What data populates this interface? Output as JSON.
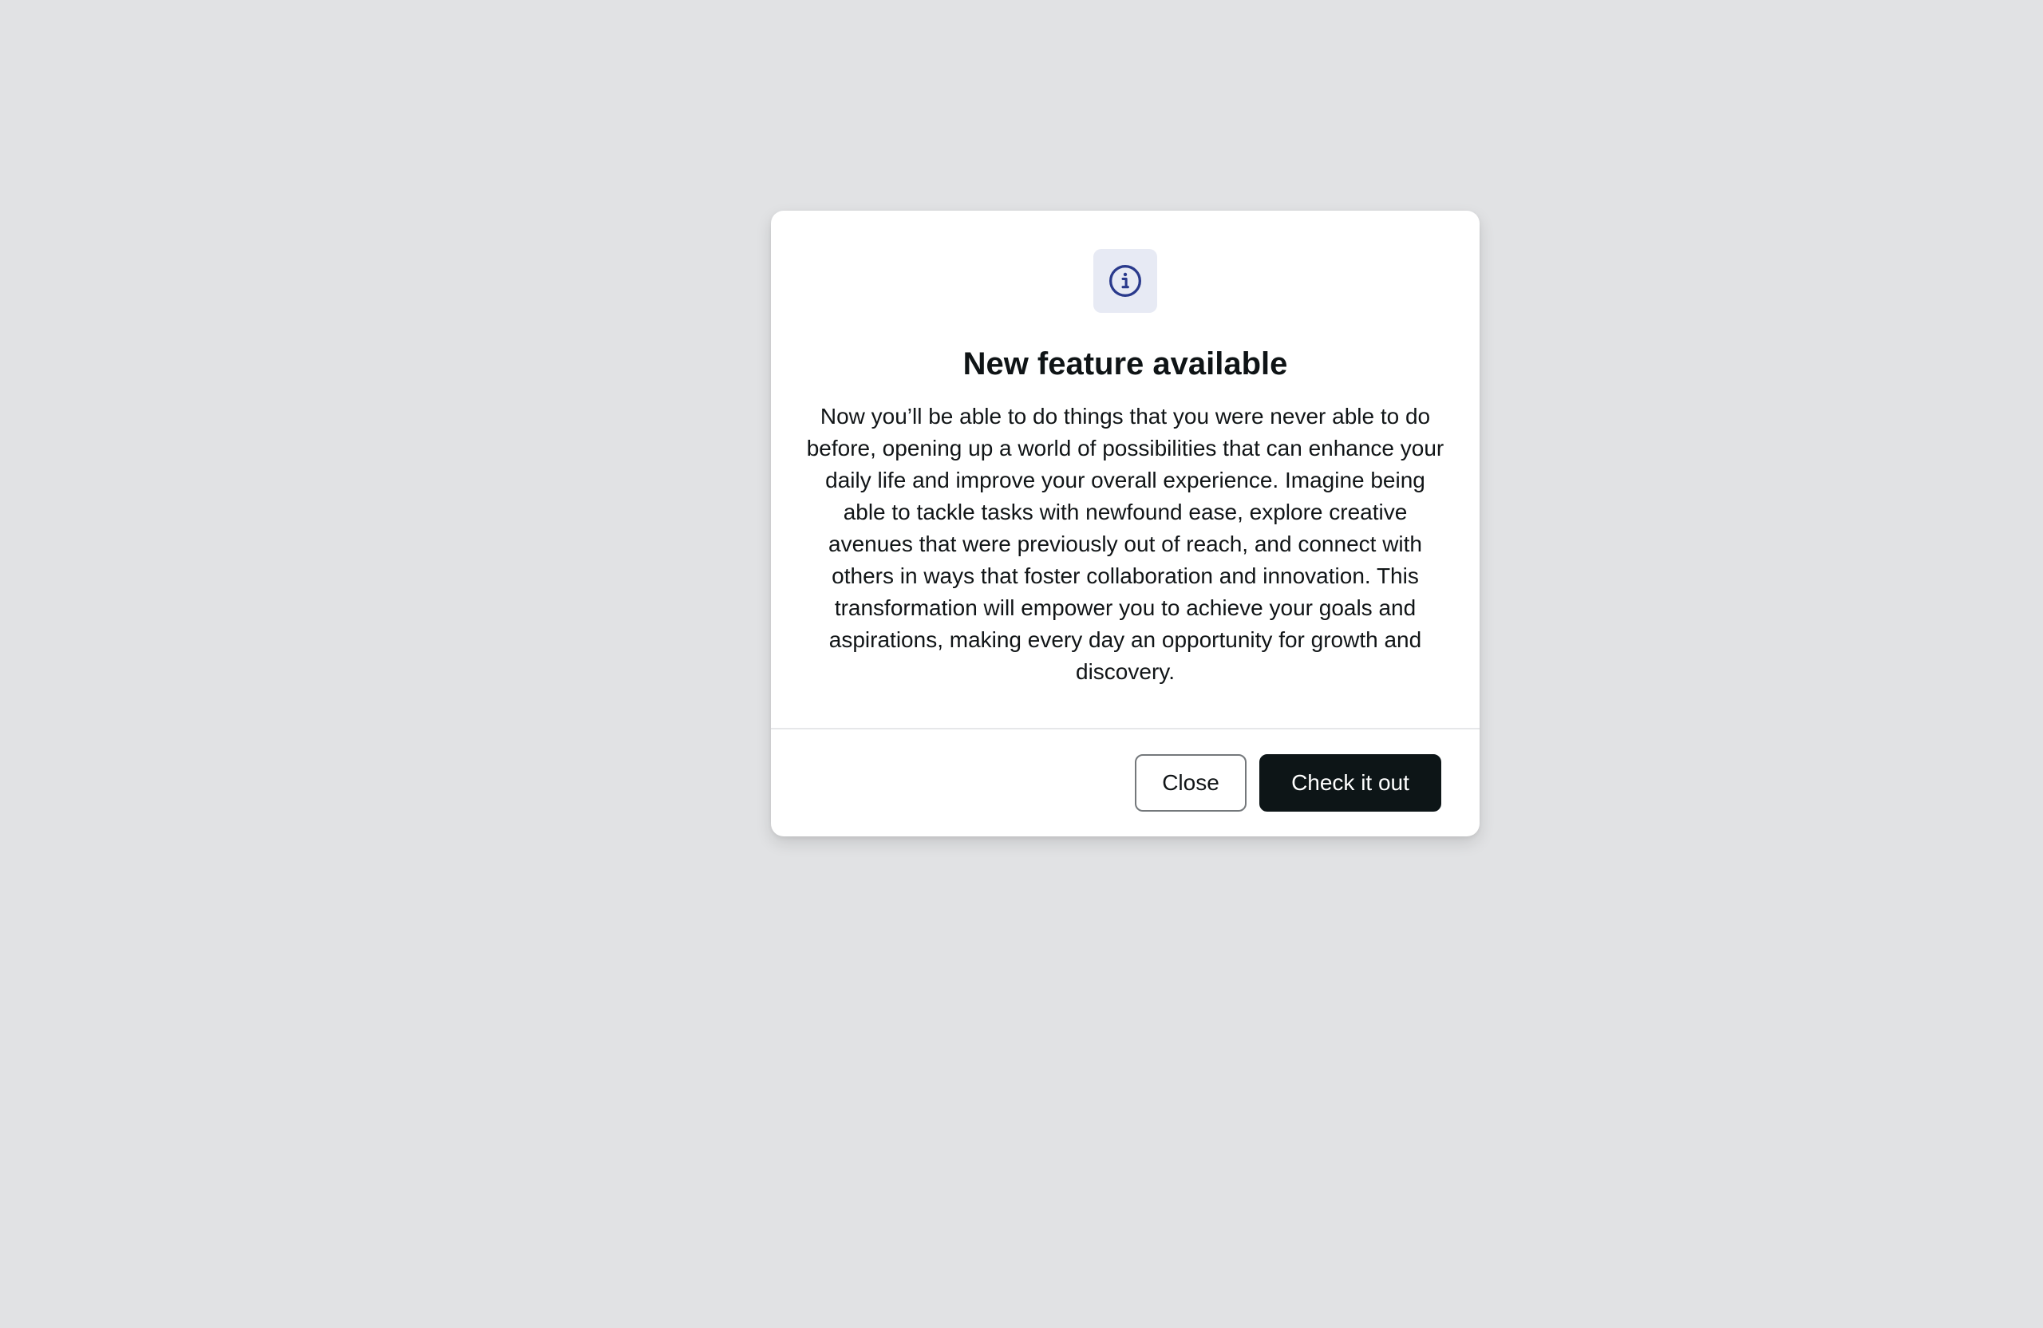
{
  "dialog": {
    "icon": "info-icon",
    "title": "New feature available",
    "description": "Now you’ll be able to do things that you were never able to do before, opening up a world of possibilities that can enhance your daily life and improve your overall experience. Imagine being able to tackle tasks with newfound ease, explore creative avenues that were previously out of reach, and connect with others in ways that foster collaboration and innovation. This transformation will empower you to achieve your goals and aspirations, making every day an opportunity for growth and discovery.",
    "close_label": "Close",
    "primary_label": "Check it out"
  },
  "colors": {
    "backdrop": "#e1e2e4",
    "icon_tile": "#e7eaf4",
    "icon_accent": "#2a3a8c",
    "primary_button": "#0d1517"
  }
}
